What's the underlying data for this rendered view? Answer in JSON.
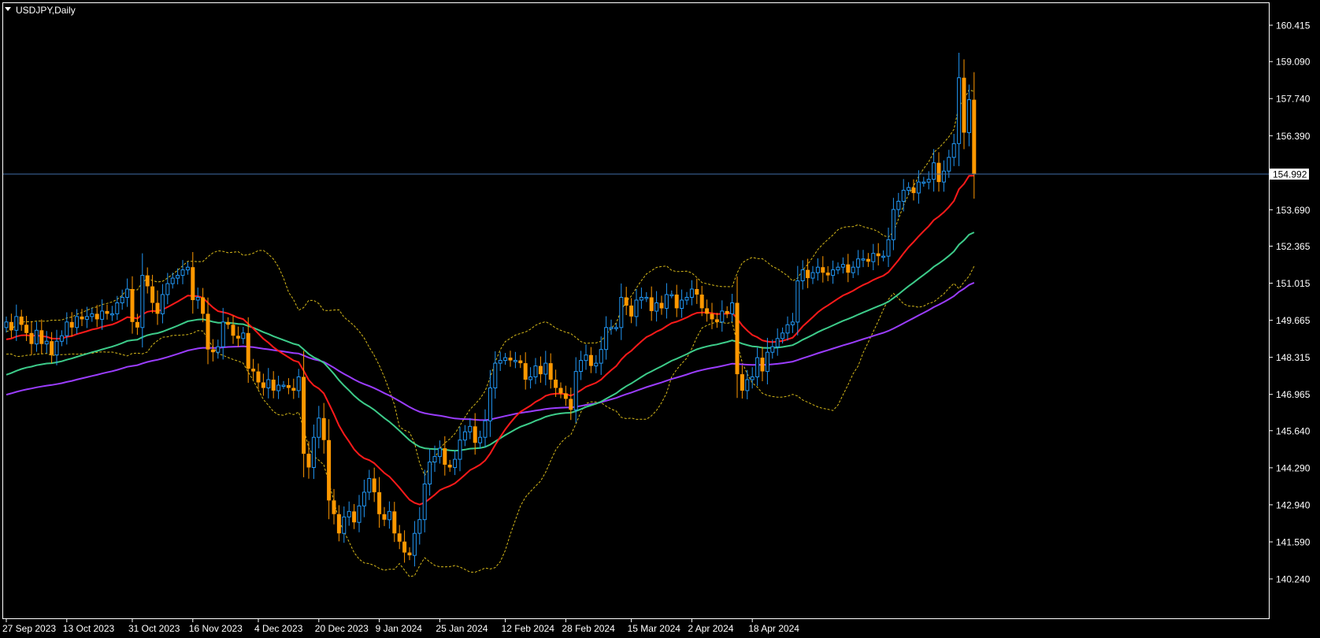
{
  "chart_data": {
    "type": "candlestick",
    "symbol": "USDJPY",
    "timeframe": "Daily",
    "title": "USDJPY,Daily",
    "colors": {
      "background": "#000000",
      "frame": "#ffffff",
      "bull": "#2196f3",
      "bear": "#ff9800",
      "current_price_line": "#3f6ea8",
      "ma_fast": "#ff1a1a",
      "ma_mid": "#3dcc8a",
      "ma_slow": "#9b3dff",
      "bands": "#d6b81a"
    },
    "y_ticks": [
      "160.415",
      "159.090",
      "157.740",
      "156.390",
      "153.690",
      "152.365",
      "151.015",
      "149.665",
      "148.315",
      "146.965",
      "145.640",
      "144.290",
      "142.940",
      "141.590",
      "140.240"
    ],
    "ylim": [
      139.8,
      160.9
    ],
    "current_price": "154.992",
    "x_ticks": [
      {
        "label": "27 Sep 2023",
        "index": 0
      },
      {
        "label": "13 Oct 2023",
        "index": 12
      },
      {
        "label": "31 Oct 2023",
        "index": 25
      },
      {
        "label": "16 Nov 2023",
        "index": 37
      },
      {
        "label": "4 Dec 2023",
        "index": 50
      },
      {
        "label": "20 Dec 2023",
        "index": 62
      },
      {
        "label": "9 Jan 2024",
        "index": 74
      },
      {
        "label": "25 Jan 2024",
        "index": 86
      },
      {
        "label": "12 Feb 2024",
        "index": 99
      },
      {
        "label": "28 Feb 2024",
        "index": 111
      },
      {
        "label": "15 Mar 2024",
        "index": 124
      },
      {
        "label": "2 Apr 2024",
        "index": 136
      },
      {
        "label": "18 Apr 2024",
        "index": 148
      }
    ],
    "closes": [
      149.6,
      149.3,
      149.8,
      149.5,
      149.2,
      148.8,
      149.3,
      148.8,
      148.9,
      148.4,
      148.9,
      149.1,
      149.6,
      149.4,
      149.8,
      149.7,
      149.8,
      149.9,
      149.7,
      150.0,
      149.9,
      149.9,
      150.3,
      150.5,
      150.8,
      149.6,
      149.4,
      151.3,
      150.9,
      150.3,
      149.9,
      150.6,
      151.0,
      151.2,
      151.3,
      151.5,
      151.6,
      150.4,
      150.5,
      149.9,
      148.6,
      148.5,
      148.7,
      149.6,
      149.5,
      149.1,
      149.0,
      149.2,
      147.9,
      147.8,
      147.4,
      147.2,
      147.5,
      147.1,
      147.3,
      147.3,
      147.2,
      147.1,
      147.6,
      144.8,
      144.3,
      145.4,
      146.1,
      145.3,
      143.1,
      142.6,
      141.9,
      142.5,
      142.7,
      142.3,
      142.9,
      143.4,
      143.9,
      143.4,
      142.6,
      142.4,
      142.7,
      141.9,
      141.6,
      141.2,
      141.1,
      141.9,
      142.4,
      143.7,
      144.5,
      144.7,
      145.0,
      144.4,
      144.3,
      144.6,
      145.3,
      145.6,
      145.8,
      145.2,
      145.4,
      146.0,
      147.2,
      148.1,
      148.2,
      148.3,
      148.2,
      148.2,
      148.1,
      147.5,
      147.6,
      148.0,
      147.7,
      148.1,
      147.5,
      147.2,
      147.0,
      146.8,
      146.4,
      147.8,
      148.2,
      148.4,
      148.0,
      148.1,
      148.6,
      149.4,
      149.4,
      149.4,
      150.5,
      150.2,
      149.8,
      150.4,
      150.5,
      150.5,
      150.0,
      150.3,
      150.1,
      150.6,
      150.6,
      150.1,
      150.4,
      150.5,
      150.8,
      150.6,
      150.1,
      149.9,
      149.7,
      149.6,
      150.0,
      149.9,
      150.3,
      147.7,
      147.1,
      147.5,
      147.6,
      148.3,
      147.8,
      148.5,
      148.7,
      149.0,
      149.2,
      149.5,
      149.6,
      151.1,
      151.5,
      151.2,
      151.4,
      151.6,
      151.4,
      151.3,
      151.5,
      151.6,
      151.7,
      151.4,
      151.6,
      151.9,
      151.9,
      151.8,
      152.1,
      152.0,
      152.0,
      152.6,
      153.7,
      154.0,
      154.4,
      154.5,
      154.3,
      154.7,
      154.7,
      154.8,
      155.4,
      154.7,
      155.1,
      155.6,
      156.1,
      158.5,
      156.5,
      157.7,
      155.0
    ]
  }
}
